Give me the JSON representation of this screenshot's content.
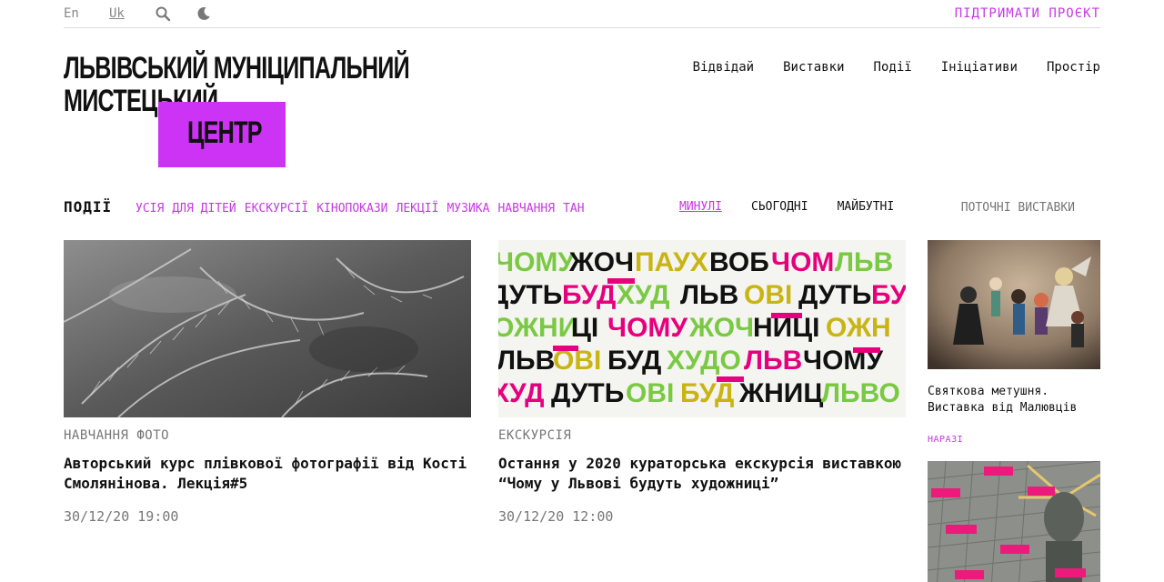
{
  "topbar": {
    "lang_en": "En",
    "lang_uk": "Uk",
    "support": "ПІДТРИМАТИ ПРОЄКТ"
  },
  "logo": {
    "line1": "ЛЬВІВСЬКИЙ МУНІЦИПАЛЬНИЙ",
    "line2": "МИСТЕЦЬКИЙ",
    "line3": "ЦЕНТР",
    "accent_color": "#cc33f5"
  },
  "nav": {
    "items": [
      "Відвідай",
      "Виставки",
      "Події",
      "Ініціативи",
      "Простір"
    ]
  },
  "filters": {
    "title": "ПОДІЇ",
    "categories": [
      "УСІЯ",
      "ДЛЯ ДІТЕЙ",
      "ЕКСКУРСІЇ",
      "КІНОПОКАЗИ",
      "ЛЕКЦІЇ",
      "МУЗИКА",
      "НАВЧАННЯ",
      "ТАН"
    ],
    "when": [
      "МИНУЛІ",
      "СЬОГОДНІ",
      "МАЙБУТНІ"
    ],
    "current": "ПОТОЧНІ ВИСТАВКИ"
  },
  "events": [
    {
      "category": "НАВЧАННЯ ФОТО",
      "title": "Авторський курс плівкової фотографії від Кості Смолянінова. Лекція#5",
      "date": "30/12/20 19:00"
    },
    {
      "category": "ЕКСКУРСІЯ",
      "title": "Остання у 2020 кураторська екскурсія виставкою “Чому у Львові будуть художниці”",
      "date": "30/12/20 12:00"
    }
  ],
  "sidebar": {
    "exhibit_title": "Святкова метушня. Виставка від Малювців",
    "now_label": "НАРАЗІ"
  }
}
